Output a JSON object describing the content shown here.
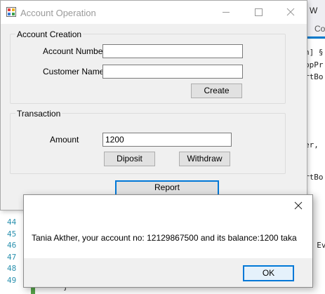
{
  "editor": {
    "tab_label_1": "W",
    "tab_label_2": "Co",
    "code_lines_right": [
      "n] §",
      "ppPr",
      "rtBo",
      "er,",
      "rtBo",
      ", Ev"
    ],
    "line_numbers": [
      "44",
      "45",
      "46",
      "47",
      "48",
      "49"
    ],
    "bottom_brace": "}",
    "colors": {
      "line_number": "#2b91af",
      "change_bar": "#57a64a",
      "tab_accent": "#007acc"
    }
  },
  "window": {
    "title": "Account Operation",
    "icon": "winforms-app-icon",
    "account_creation": {
      "legend": "Account Creation",
      "account_number_label": "Account Number",
      "account_number_value": "",
      "customer_name_label": "Customer Name",
      "customer_name_value": "",
      "create_label": "Create"
    },
    "transaction": {
      "legend": "Transaction",
      "amount_label": "Amount",
      "amount_value": "1200",
      "deposit_label": "Diposit",
      "withdraw_label": "Withdraw"
    },
    "report_label": "Report"
  },
  "dialog": {
    "message": "Tania Akther, your account no: 12129867500 and its balance:1200 taka",
    "ok_label": "OK",
    "accent_color": "#0078d7"
  }
}
